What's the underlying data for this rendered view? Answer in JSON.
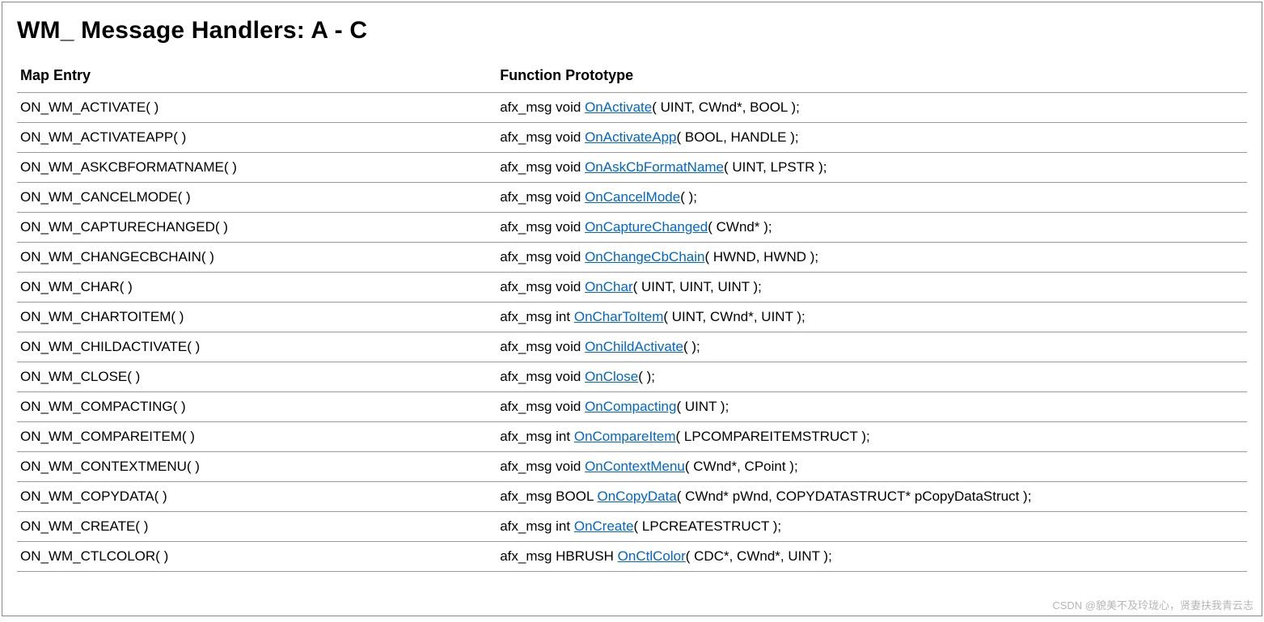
{
  "title": "WM_ Message Handlers: A - C",
  "columns": {
    "map_entry": "Map Entry",
    "function_prototype": "Function Prototype"
  },
  "rows": [
    {
      "map": "ON_WM_ACTIVATE( )",
      "prefix": "afx_msg void ",
      "link": "OnActivate",
      "suffix": "( UINT, CWnd*, BOOL );"
    },
    {
      "map": "ON_WM_ACTIVATEAPP( )",
      "prefix": "afx_msg void ",
      "link": "OnActivateApp",
      "suffix": "( BOOL, HANDLE );"
    },
    {
      "map": "ON_WM_ASKCBFORMATNAME( )",
      "prefix": "afx_msg void ",
      "link": "OnAskCbFormatName",
      "suffix": "( UINT, LPSTR );"
    },
    {
      "map": "ON_WM_CANCELMODE( )",
      "prefix": "afx_msg void ",
      "link": "OnCancelMode",
      "suffix": "( );"
    },
    {
      "map": "ON_WM_CAPTURECHANGED( )",
      "prefix": "afx_msg void ",
      "link": "OnCaptureChanged",
      "suffix": "( CWnd* );"
    },
    {
      "map": "ON_WM_CHANGECBCHAIN( )",
      "prefix": "afx_msg void ",
      "link": "OnChangeCbChain",
      "suffix": "( HWND, HWND );"
    },
    {
      "map": "ON_WM_CHAR( )",
      "prefix": "afx_msg void ",
      "link": "OnChar",
      "suffix": "( UINT, UINT, UINT );"
    },
    {
      "map": "ON_WM_CHARTOITEM( )",
      "prefix": "afx_msg int ",
      "link": "OnCharToItem",
      "suffix": "( UINT, CWnd*, UINT );"
    },
    {
      "map": "ON_WM_CHILDACTIVATE( )",
      "prefix": "afx_msg void ",
      "link": "OnChildActivate",
      "suffix": "( );"
    },
    {
      "map": "ON_WM_CLOSE( )",
      "prefix": "afx_msg void ",
      "link": "OnClose",
      "suffix": "( );"
    },
    {
      "map": "ON_WM_COMPACTING( )",
      "prefix": "afx_msg void ",
      "link": "OnCompacting",
      "suffix": "( UINT );"
    },
    {
      "map": "ON_WM_COMPAREITEM( )",
      "prefix": "afx_msg int ",
      "link": "OnCompareItem",
      "suffix": "( LPCOMPAREITEMSTRUCT );"
    },
    {
      "map": "ON_WM_CONTEXTMENU( )",
      "prefix": "afx_msg void ",
      "link": "OnContextMenu",
      "suffix": "( CWnd*, CPoint );"
    },
    {
      "map": "ON_WM_COPYDATA( )",
      "prefix": "afx_msg BOOL ",
      "link": "OnCopyData",
      "suffix": "( CWnd* pWnd, COPYDATASTRUCT* pCopyDataStruct );"
    },
    {
      "map": "ON_WM_CREATE( )",
      "prefix": "afx_msg int ",
      "link": "OnCreate",
      "suffix": "( LPCREATESTRUCT );"
    },
    {
      "map": "ON_WM_CTLCOLOR( )",
      "prefix": "afx_msg HBRUSH ",
      "link": "OnCtlColor",
      "suffix": "( CDC*, CWnd*, UINT );"
    }
  ],
  "watermark": "CSDN @貌美不及玲珑心，贤妻扶我青云志"
}
